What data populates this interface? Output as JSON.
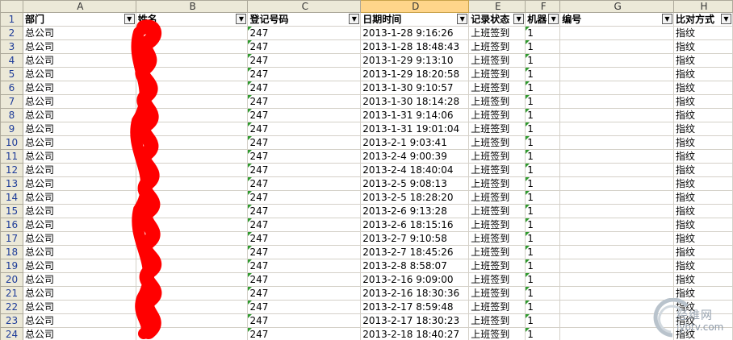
{
  "columns": [
    "",
    "A",
    "B",
    "C",
    "D",
    "E",
    "F",
    "G",
    "H"
  ],
  "selected_column": "D",
  "header_row_number": "1",
  "headers": [
    "部门",
    "姓名",
    "登记号码",
    "日期时间",
    "记录状态",
    "机器",
    "编号",
    "比对方式"
  ],
  "rows": [
    {
      "n": "2",
      "dept": "总公司",
      "name": "",
      "id": "247",
      "dt": "2013-1-28 9:16:26",
      "status": "上班签到",
      "machine": "1",
      "no": "",
      "method": "指纹"
    },
    {
      "n": "3",
      "dept": "总公司",
      "name": "",
      "id": "247",
      "dt": "2013-1-28 18:48:43",
      "status": "上班签到",
      "machine": "1",
      "no": "",
      "method": "指纹"
    },
    {
      "n": "4",
      "dept": "总公司",
      "name": "",
      "id": "247",
      "dt": "2013-1-29 9:13:10",
      "status": "上班签到",
      "machine": "1",
      "no": "",
      "method": "指纹"
    },
    {
      "n": "5",
      "dept": "总公司",
      "name": "",
      "id": "247",
      "dt": "2013-1-29 18:20:58",
      "status": "上班签到",
      "machine": "1",
      "no": "",
      "method": "指纹"
    },
    {
      "n": "6",
      "dept": "总公司",
      "name": "",
      "id": "247",
      "dt": "2013-1-30 9:10:57",
      "status": "上班签到",
      "machine": "1",
      "no": "",
      "method": "指纹"
    },
    {
      "n": "7",
      "dept": "总公司",
      "name": "",
      "id": "247",
      "dt": "2013-1-30 18:14:28",
      "status": "上班签到",
      "machine": "1",
      "no": "",
      "method": "指纹"
    },
    {
      "n": "8",
      "dept": "总公司",
      "name": "",
      "id": "247",
      "dt": "2013-1-31 9:14:06",
      "status": "上班签到",
      "machine": "1",
      "no": "",
      "method": "指纹"
    },
    {
      "n": "9",
      "dept": "总公司",
      "name": "",
      "id": "247",
      "dt": "2013-1-31 19:01:04",
      "status": "上班签到",
      "machine": "1",
      "no": "",
      "method": "指纹"
    },
    {
      "n": "10",
      "dept": "总公司",
      "name": "",
      "id": "247",
      "dt": "2013-2-1 9:03:41",
      "status": "上班签到",
      "machine": "1",
      "no": "",
      "method": "指纹"
    },
    {
      "n": "11",
      "dept": "总公司",
      "name": "",
      "id": "247",
      "dt": "2013-2-4 9:00:39",
      "status": "上班签到",
      "machine": "1",
      "no": "",
      "method": "指纹"
    },
    {
      "n": "12",
      "dept": "总公司",
      "name": "",
      "id": "247",
      "dt": "2013-2-4 18:40:04",
      "status": "上班签到",
      "machine": "1",
      "no": "",
      "method": "指纹"
    },
    {
      "n": "13",
      "dept": "总公司",
      "name": "",
      "id": "247",
      "dt": "2013-2-5 9:08:13",
      "status": "上班签到",
      "machine": "1",
      "no": "",
      "method": "指纹"
    },
    {
      "n": "14",
      "dept": "总公司",
      "name": "",
      "id": "247",
      "dt": "2013-2-5 18:28:20",
      "status": "上班签到",
      "machine": "1",
      "no": "",
      "method": "指纹"
    },
    {
      "n": "15",
      "dept": "总公司",
      "name": "",
      "id": "247",
      "dt": "2013-2-6 9:13:28",
      "status": "上班签到",
      "machine": "1",
      "no": "",
      "method": "指纹"
    },
    {
      "n": "16",
      "dept": "总公司",
      "name": "",
      "id": "247",
      "dt": "2013-2-6 18:15:16",
      "status": "上班签到",
      "machine": "1",
      "no": "",
      "method": "指纹"
    },
    {
      "n": "17",
      "dept": "总公司",
      "name": "",
      "id": "247",
      "dt": "2013-2-7 9:10:58",
      "status": "上班签到",
      "machine": "1",
      "no": "",
      "method": "指纹"
    },
    {
      "n": "18",
      "dept": "总公司",
      "name": "",
      "id": "247",
      "dt": "2013-2-7 18:45:26",
      "status": "上班签到",
      "machine": "1",
      "no": "",
      "method": "指纹"
    },
    {
      "n": "19",
      "dept": "总公司",
      "name": "",
      "id": "247",
      "dt": "2013-2-8 8:58:07",
      "status": "上班签到",
      "machine": "1",
      "no": "",
      "method": "指纹"
    },
    {
      "n": "20",
      "dept": "总公司",
      "name": "",
      "id": "247",
      "dt": "2013-2-16 9:09:00",
      "status": "上班签到",
      "machine": "1",
      "no": "",
      "method": "指纹"
    },
    {
      "n": "21",
      "dept": "总公司",
      "name": "",
      "id": "247",
      "dt": "2013-2-16 18:30:36",
      "status": "上班签到",
      "machine": "1",
      "no": "",
      "method": "指纹"
    },
    {
      "n": "22",
      "dept": "总公司",
      "name": "",
      "id": "247",
      "dt": "2013-2-17 8:59:48",
      "status": "上班签到",
      "machine": "1",
      "no": "",
      "method": "指纹"
    },
    {
      "n": "23",
      "dept": "总公司",
      "name": "",
      "id": "247",
      "dt": "2013-2-17 18:30:23",
      "status": "上班签到",
      "machine": "1",
      "no": "",
      "method": "指纹"
    },
    {
      "n": "24",
      "dept": "总公司",
      "name": "",
      "id": "247",
      "dt": "2013-2-18 18:40:27",
      "status": "上班签到",
      "machine": "1",
      "no": "",
      "method": "指纹"
    }
  ],
  "watermark": {
    "text": "经维网",
    "url": "iybtv.com"
  },
  "colors": {
    "header_bg": "#ece9d8",
    "selected_col": "#ffd58a",
    "redaction": "#ff0000",
    "number_marker": "#2e9a2e",
    "row_number": "#1f3d99"
  },
  "icons": [
    "filter-dropdown-icon",
    "number-as-text-indicator-icon",
    "watermark-logo-icon"
  ]
}
